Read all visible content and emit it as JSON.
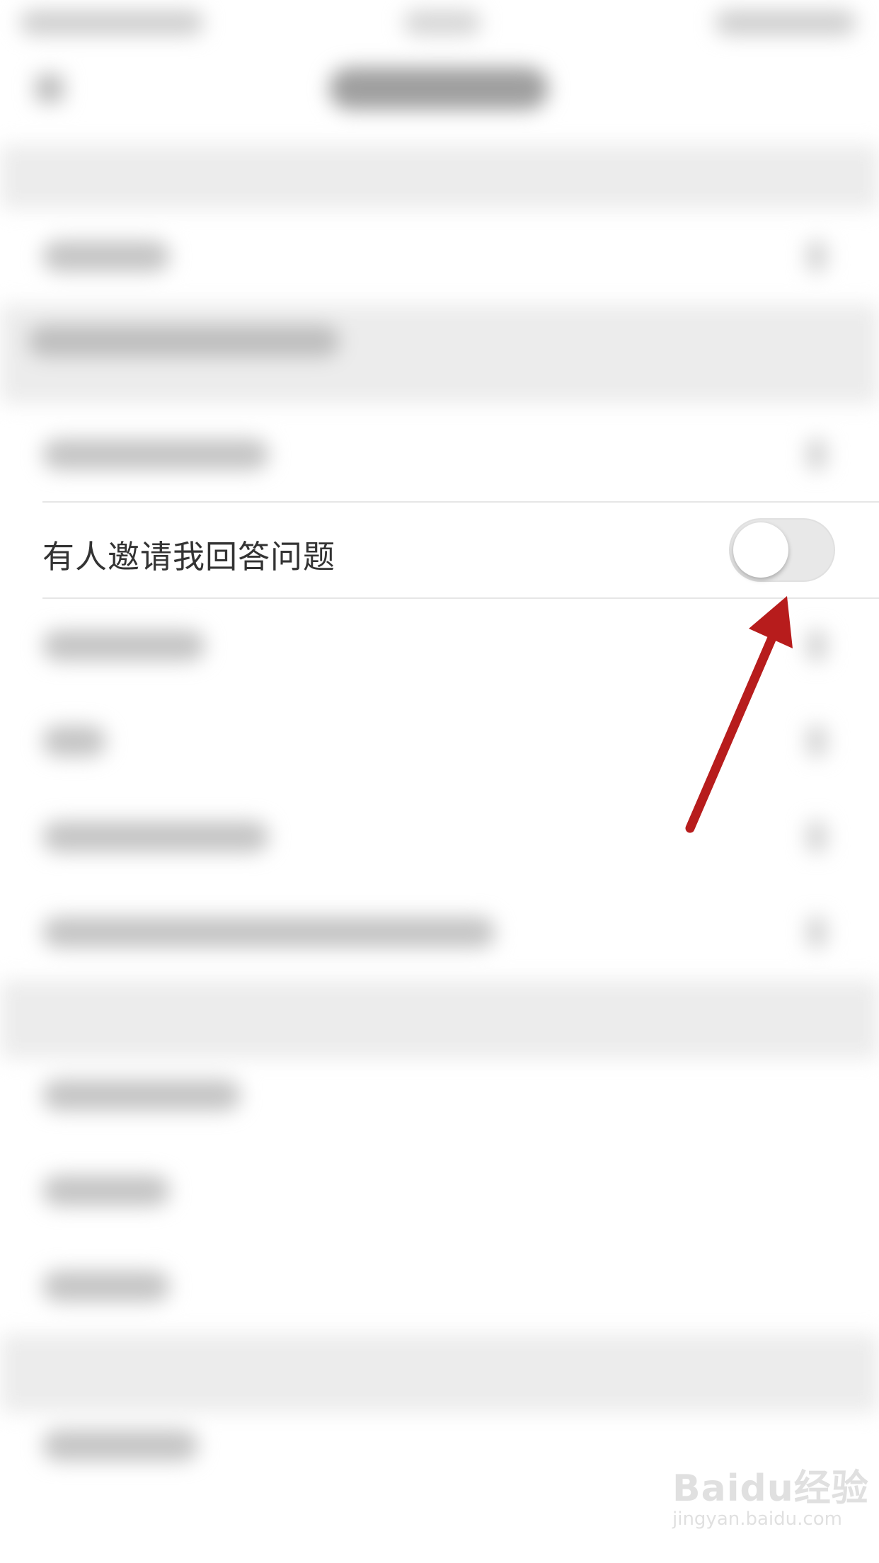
{
  "settings": {
    "invite_answer": {
      "label": "有人邀请我回答问题",
      "toggle_on": false
    }
  },
  "colors": {
    "annotation_arrow": "#b71c1c",
    "toggle_track_off": "#e8e8e8"
  },
  "watermark": {
    "logo": "Baidu经验",
    "url": "jingyan.baidu.com"
  },
  "icons": {
    "annotation": "red-arrow-icon"
  }
}
